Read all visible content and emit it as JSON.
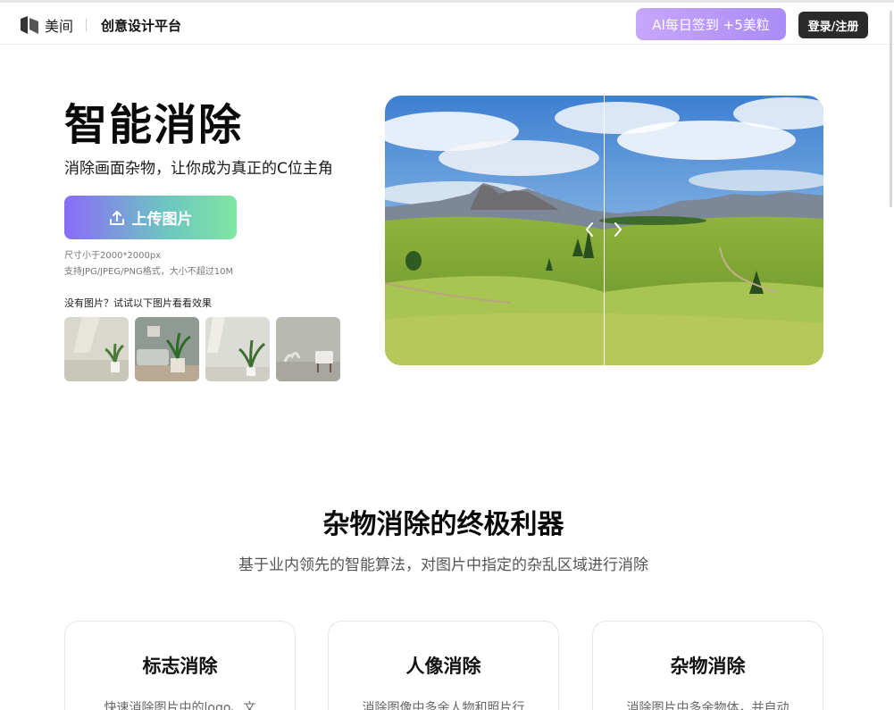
{
  "header": {
    "brand": "美间",
    "platform": "创意设计平台",
    "ai_button": "AI每日签到 +5美粒",
    "login_button": "登录/注册"
  },
  "hero": {
    "title": "智能消除",
    "subtitle": "消除画面杂物，让你成为真正的C位主角",
    "upload_label": "上传图片",
    "hint_size": "尺寸小于2000*2000px",
    "hint_format": "支持JPG/JPEG/PNG格式，大小不超过10M",
    "try_label": "没有图片？试试以下图片看看效果",
    "samples": [
      "sample-room-plant-1",
      "sample-room-sofa",
      "sample-room-plant-2",
      "sample-room-chair"
    ]
  },
  "section": {
    "title": "杂物消除的终极利器",
    "subtitle": "基于业内领先的智能算法，对图片中指定的杂乱区域进行消除"
  },
  "cards": [
    {
      "title": "标志消除",
      "desc": "快速消除图片中的logo、文"
    },
    {
      "title": "人像消除",
      "desc": "消除图像中多余人物和照片行"
    },
    {
      "title": "杂物消除",
      "desc": "消除图片中多余物体，并自动"
    }
  ],
  "colors": {
    "accent_purple": "#8a6bfa",
    "accent_green": "#7fe6a3",
    "ai_button": "#b89af8",
    "dark_button": "#2a2a2a"
  }
}
